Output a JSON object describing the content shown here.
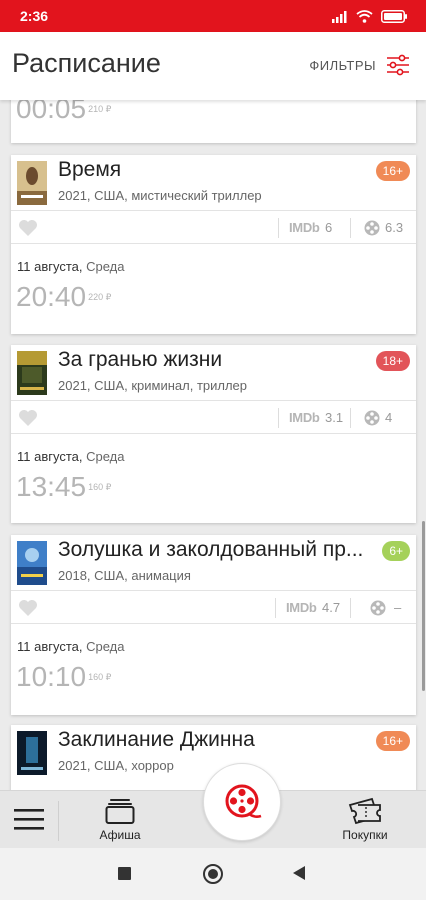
{
  "status_bar": {
    "time": "2:36"
  },
  "header": {
    "title": "Расписание",
    "filters_label": "ФИЛЬТРЫ"
  },
  "partial_card": {
    "time": "00:05",
    "price": "210 ₽"
  },
  "movies": [
    {
      "title": "Время",
      "meta": "2021, США, мистический триллер",
      "age": "16+",
      "age_color": "#f08a56",
      "imdb_label": "IMDb",
      "imdb": "6",
      "kp": "6.3",
      "date": "11 августа,",
      "dow": " Среда",
      "time": "20:40",
      "price": "220 ₽"
    },
    {
      "title": "За гранью жизни",
      "meta": "2021, США, криминал, триллер",
      "age": "18+",
      "age_color": "#e25459",
      "imdb_label": "IMDb",
      "imdb": "3.1",
      "kp": "4",
      "date": "11 августа,",
      "dow": " Среда",
      "time": "13:45",
      "price": "160 ₽"
    },
    {
      "title": "Золушка и заколдованный пр...",
      "meta": "2018, США, анимация",
      "age": "6+",
      "age_color": "#a5d15a",
      "imdb_label": "IMDb",
      "imdb": "4.7",
      "kp": "–",
      "date": "11 августа,",
      "dow": " Среда",
      "time": "10:10",
      "price": "160 ₽"
    },
    {
      "title": "Заклинание Джинна",
      "meta": "2021, США, хоррор",
      "age": "16+",
      "age_color": "#f08a56"
    }
  ],
  "bottom_nav": {
    "afisha_label": "Афиша",
    "purchases_label": "Покупки"
  },
  "colors": {
    "brand": "#e2141d",
    "muted": "#b5b5b5"
  }
}
